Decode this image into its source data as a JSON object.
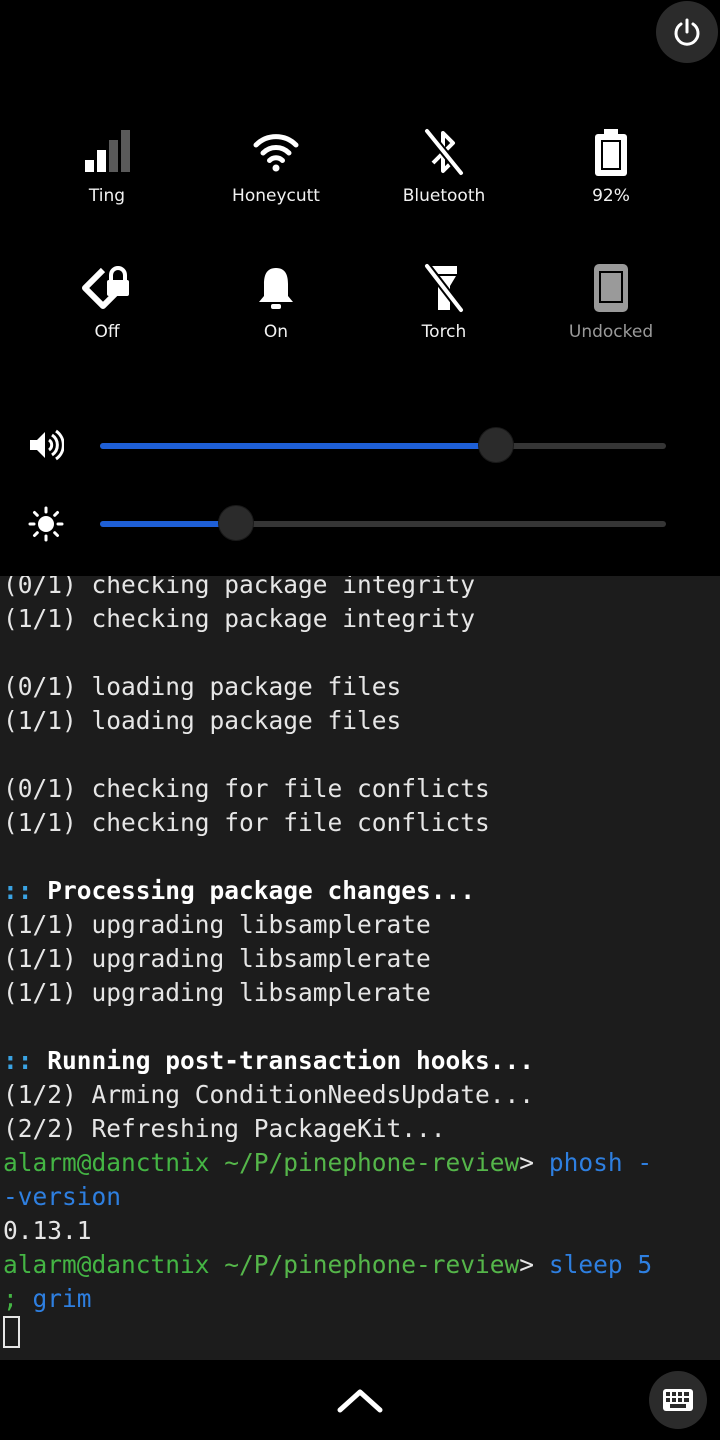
{
  "quick_settings": {
    "tiles": [
      {
        "label": "Ting",
        "icon": "cellular-signal-icon"
      },
      {
        "label": "Honeycutt",
        "icon": "wifi-icon"
      },
      {
        "label": "Bluetooth",
        "icon": "bluetooth-disabled-icon"
      },
      {
        "label": "92%",
        "icon": "battery-icon"
      },
      {
        "label": "Off",
        "icon": "rotation-lock-icon"
      },
      {
        "label": "On",
        "icon": "notification-bell-icon"
      },
      {
        "label": "Torch",
        "icon": "flashlight-icon"
      },
      {
        "label": "Undocked",
        "icon": "phone-undocked-icon"
      }
    ],
    "volume_level": 0.7,
    "brightness_level": 0.24,
    "accent_color": "#1e5fd6"
  },
  "terminal": {
    "lines": [
      "(0/1) checking package integrity",
      "(1/1) checking package integrity",
      "",
      "(0/1) loading package files",
      "(1/1) loading package files",
      "",
      "(0/1) checking for file conflicts",
      "(1/1) checking for file conflicts",
      ""
    ],
    "section1_marker": "::",
    "section1_title": "Processing package changes...",
    "section1_lines": [
      "(1/1) upgrading libsamplerate",
      "(1/1) upgrading libsamplerate",
      "(1/1) upgrading libsamplerate"
    ],
    "section2_marker": "::",
    "section2_title": "Running post-transaction hooks...",
    "section2_lines": [
      "(1/2) Arming ConditionNeedsUpdate...",
      "(2/2) Refreshing PackageKit..."
    ],
    "prompt_user": "alarm@danctnix",
    "prompt_path": "~/P/pinephone-review",
    "prompt_sym": ">",
    "cmd1_a": "phosh -",
    "cmd1_b": "-version",
    "output1": "0.13.1",
    "cmd2_a": "sleep 5",
    "cmd2_semicolon": ";",
    "cmd2_b": "grim"
  }
}
